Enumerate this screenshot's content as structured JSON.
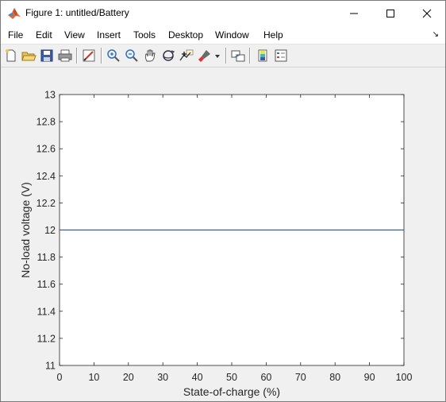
{
  "window": {
    "title": "Figure 1: untitled/Battery"
  },
  "menubar": {
    "items": [
      "File",
      "Edit",
      "View",
      "Insert",
      "Tools",
      "Desktop",
      "Window",
      "Help"
    ]
  },
  "toolbar": {
    "buttons": [
      "new-figure-icon",
      "open-file-icon",
      "save-icon",
      "print-icon",
      "edit-plot-icon",
      "zoom-in-icon",
      "zoom-out-icon",
      "pan-icon",
      "rotate-3d-icon",
      "data-cursor-icon",
      "brush-icon",
      "link-plot-icon",
      "colorbar-icon",
      "legend-icon"
    ]
  },
  "chart_data": {
    "type": "line",
    "xlabel": "State-of-charge (%)",
    "ylabel": "No-load voltage (V)",
    "xlim": [
      0,
      100
    ],
    "ylim": [
      11,
      13
    ],
    "xticks": [
      "0",
      "10",
      "20",
      "30",
      "40",
      "50",
      "60",
      "70",
      "80",
      "90",
      "100"
    ],
    "yticks": [
      "11",
      "11.2",
      "11.4",
      "11.6",
      "11.8",
      "12",
      "12.2",
      "12.4",
      "12.6",
      "12.8",
      "13"
    ],
    "series": [
      {
        "x": [
          0,
          100
        ],
        "y": [
          12,
          12
        ],
        "color": "#0072bd"
      }
    ],
    "grid": false
  }
}
